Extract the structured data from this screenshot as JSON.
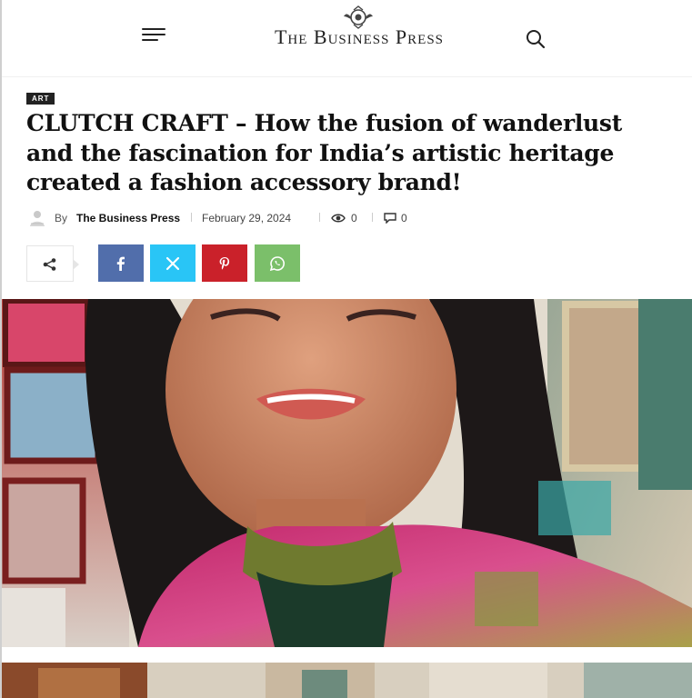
{
  "header": {
    "site_title": "The Business Press",
    "icons": {
      "menu": "hamburger-menu-icon",
      "search": "search-icon",
      "logo": "emblem-logo-icon"
    }
  },
  "article": {
    "category": "ART",
    "headline": "CLUTCH CRAFT – How the fusion of wanderlust and the fascination for India’s artistic heritage created a fashion accessory brand!",
    "meta": {
      "by_label": "By",
      "author": "The Business Press",
      "date": "February 29, 2024",
      "views": "0",
      "comments": "0"
    }
  },
  "share": {
    "buttons": [
      {
        "name": "facebook",
        "icon": "facebook-icon",
        "color": "#516eab"
      },
      {
        "name": "x",
        "icon": "x-icon",
        "color": "#29c5f6"
      },
      {
        "name": "pinterest",
        "icon": "pinterest-icon",
        "color": "#ca212a"
      },
      {
        "name": "whatsapp",
        "icon": "whatsapp-icon",
        "color": "#7bbf6a"
      }
    ]
  }
}
